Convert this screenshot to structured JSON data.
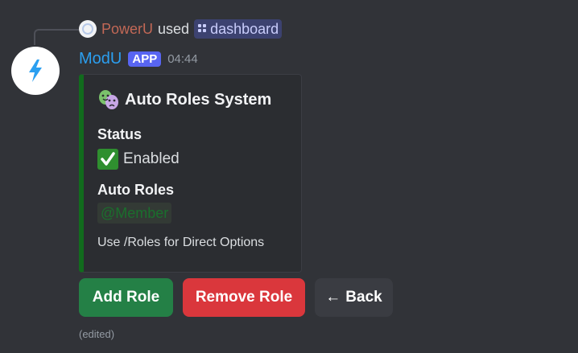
{
  "reply": {
    "user": "PowerU",
    "used_text": "used",
    "command_icon": "slash-command-icon",
    "command": "dashboard"
  },
  "message": {
    "avatar_icon": "lightning-bolt-icon",
    "username": "ModU",
    "badge": "APP",
    "timestamp": "04:44",
    "edited_label": "(edited)"
  },
  "embed": {
    "accent_color": "#116b1d",
    "title_icon": "performing-arts-masks-icon",
    "title": "Auto Roles System",
    "fields": [
      {
        "name": "Status",
        "value_icon": "check-mark-button-icon",
        "value": "Enabled"
      },
      {
        "name": "Auto Roles",
        "value": "@Member"
      }
    ],
    "footer": "Use /Roles for Direct Options"
  },
  "buttons": [
    {
      "label": "Add Role",
      "color": "#248046"
    },
    {
      "label": "Remove Role",
      "color": "#da373c"
    },
    {
      "label": "Back",
      "icon": "left-arrow-icon",
      "icon_glyph": "←",
      "color": "#3a3c42"
    }
  ],
  "colors": {
    "background": "#313338",
    "username": "#2b9ff0",
    "reply_user": "#c26856",
    "badge": "#5865f2"
  }
}
